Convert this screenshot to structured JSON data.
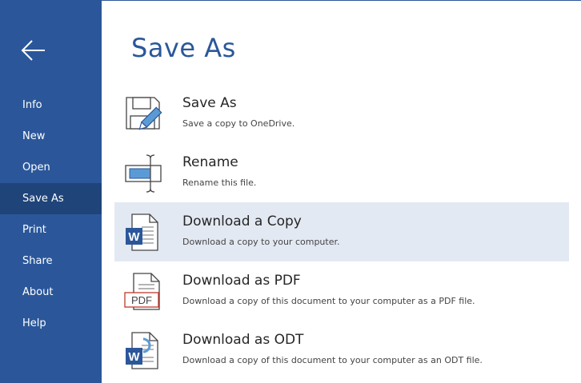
{
  "sidebar": {
    "items": [
      {
        "label": "Info"
      },
      {
        "label": "New"
      },
      {
        "label": "Open"
      },
      {
        "label": "Save As"
      },
      {
        "label": "Print"
      },
      {
        "label": "Share"
      },
      {
        "label": "About"
      },
      {
        "label": "Help"
      }
    ],
    "active_item": "Save As",
    "accent_color": "#2b579a",
    "active_color": "#1f4479"
  },
  "main": {
    "title": "Save As",
    "options": [
      {
        "title": "Save As",
        "desc": "Save a copy to OneDrive.",
        "icon": "save-as-icon"
      },
      {
        "title": "Rename",
        "desc": "Rename this file.",
        "icon": "rename-icon"
      },
      {
        "title": "Download a Copy",
        "desc": "Download a copy to your computer.",
        "icon": "word-document-icon"
      },
      {
        "title": "Download as PDF",
        "desc": "Download a copy of this document to your computer as a PDF file.",
        "icon": "pdf-document-icon",
        "badge": "PDF"
      },
      {
        "title": "Download as ODT",
        "desc": "Download a copy of this document to your computer as an ODT file.",
        "icon": "odt-document-icon"
      }
    ],
    "selected_option": "Download a Copy",
    "highlight_color": "#e3e9f3"
  }
}
